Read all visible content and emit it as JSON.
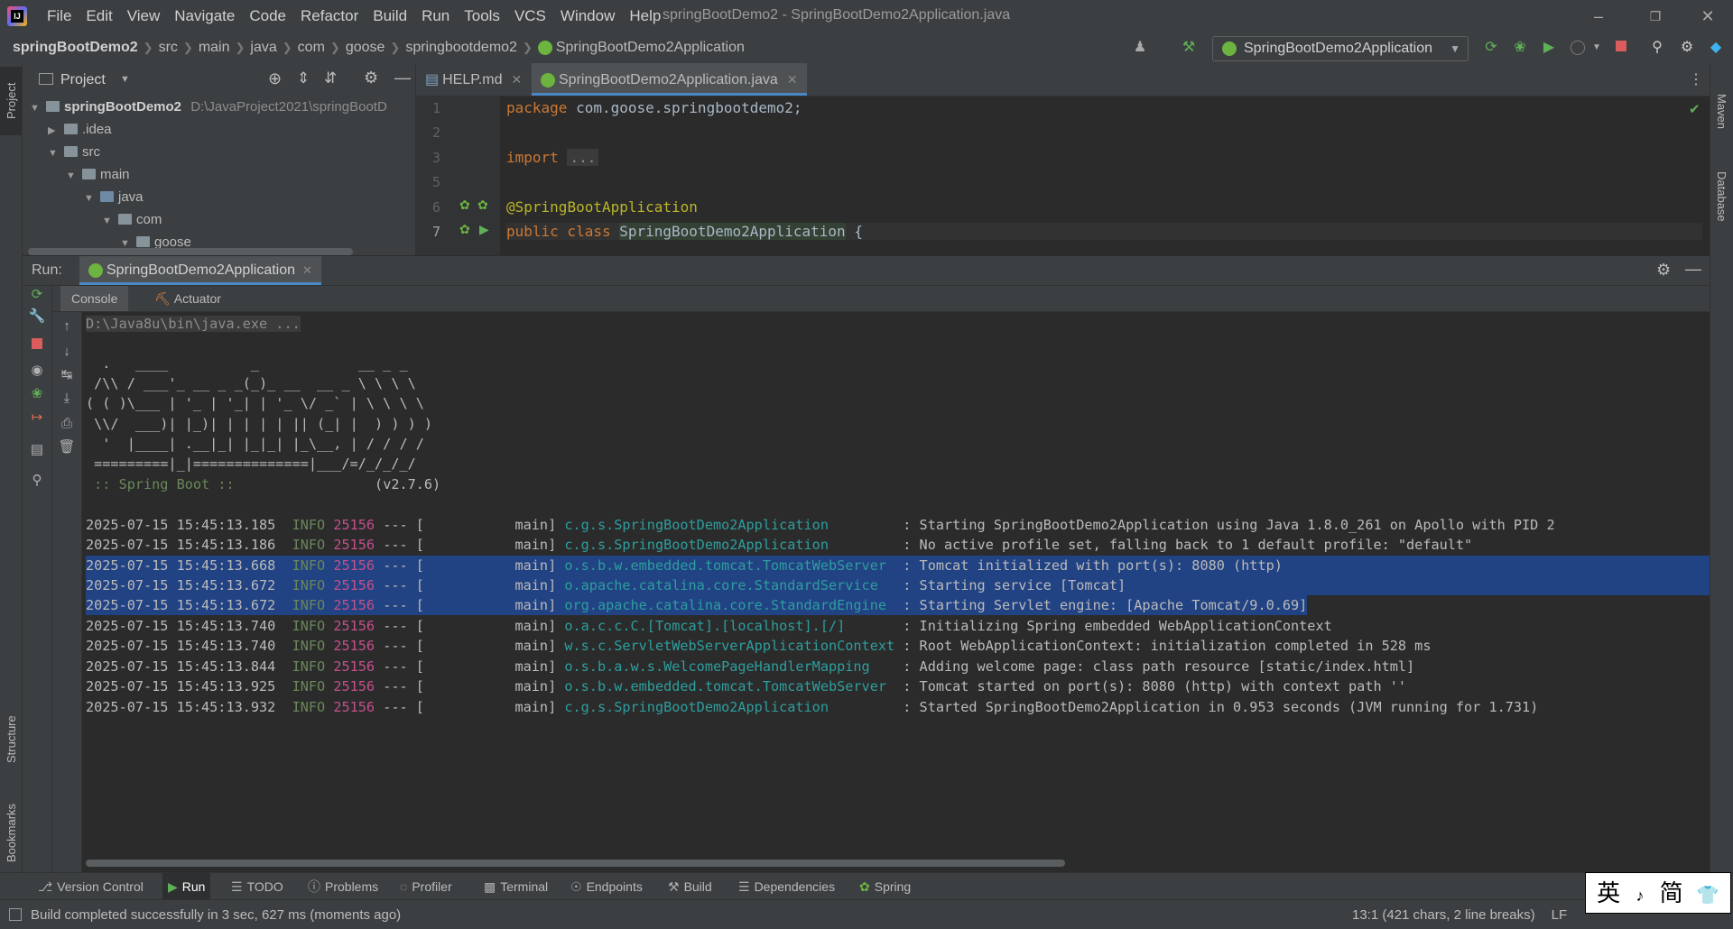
{
  "app_title": "springBootDemo2 - SpringBootDemo2Application.java",
  "menu": [
    "File",
    "Edit",
    "View",
    "Navigate",
    "Code",
    "Refactor",
    "Build",
    "Run",
    "Tools",
    "VCS",
    "Window",
    "Help"
  ],
  "breadcrumbs": [
    "springBootDemo2",
    "src",
    "main",
    "java",
    "com",
    "goose",
    "springbootdemo2",
    "SpringBootDemo2Application"
  ],
  "run_config": "SpringBootDemo2Application",
  "left_stripe": {
    "project": "Project",
    "structure": "Structure",
    "bookmarks": "Bookmarks"
  },
  "right_stripe": {
    "maven": "Maven",
    "database": "Database"
  },
  "project_panel": {
    "title": "Project",
    "tree": [
      {
        "label": "springBootDemo2",
        "path": "D:\\JavaProject2021\\springBootD"
      },
      {
        "label": ".idea"
      },
      {
        "label": "src"
      },
      {
        "label": "main"
      },
      {
        "label": "java"
      },
      {
        "label": "com"
      },
      {
        "label": "goose"
      }
    ]
  },
  "editor": {
    "tabs": [
      {
        "label": "HELP.md"
      },
      {
        "label": "SpringBootDemo2Application.java"
      }
    ],
    "line_numbers": [
      "1",
      "2",
      "3",
      "5",
      "6",
      "7"
    ],
    "code": {
      "l1_kw": "package",
      "l1_rest": " com.goose.springbootdemo2;",
      "l3_kw": "import",
      "l3_fold": "...",
      "l6_at": "@",
      "l6_ann": "SpringBootApplication",
      "l7_kw": "public class",
      "l7_cls": "SpringBootDemo2Application",
      "l7_brace": " {"
    }
  },
  "run_panel": {
    "label": "Run:",
    "tab": "SpringBootDemo2Application",
    "subtabs": [
      "Console",
      "Actuator"
    ],
    "cmdline": "D:\\Java8u\\bin\\java.exe ...",
    "banner": [
      "  .   ____          _            __ _ _",
      " /\\\\ / ___'_ __ _ _(_)_ __  __ _ \\ \\ \\ \\",
      "( ( )\\___ | '_ | '_| | '_ \\/ _` | \\ \\ \\ \\",
      " \\\\/  ___)| |_)| | | | | || (_| |  ) ) ) )",
      "  '  |____| .__|_| |_|_| |_\\__, | / / / /",
      " =========|_|==============|___/=/_/_/_/"
    ],
    "boot_label": " :: Spring Boot ::",
    "boot_version": "(v2.7.6)",
    "logs": [
      {
        "ts": "2025-07-15 15:45:13.185",
        "level": "INFO",
        "pid": "25156",
        "thread": " --- [           main] ",
        "logger": "c.g.s.SpringBootDemo2Application        ",
        "msg": " : Starting SpringBootDemo2Application using Java 1.8.0_261 on Apollo with PID 2"
      },
      {
        "ts": "2025-07-15 15:45:13.186",
        "level": "INFO",
        "pid": "25156",
        "thread": " --- [           main] ",
        "logger": "c.g.s.SpringBootDemo2Application        ",
        "msg": " : No active profile set, falling back to 1 default profile: \"default\""
      },
      {
        "ts": "2025-07-15 15:45:13.668",
        "level": "INFO",
        "pid": "25156",
        "thread": " --- [           main] ",
        "logger": "o.s.b.w.embedded.tomcat.TomcatWebServer ",
        "msg": " : Tomcat initialized with port(s): 8080 (http)"
      },
      {
        "ts": "2025-07-15 15:45:13.672",
        "level": "INFO",
        "pid": "25156",
        "thread": " --- [           main] ",
        "logger": "o.apache.catalina.core.StandardService  ",
        "msg": " : Starting service [Tomcat]"
      },
      {
        "ts": "2025-07-15 15:45:13.672",
        "level": "INFO",
        "pid": "25156",
        "thread": " --- [           main] ",
        "logger": "org.apache.catalina.core.StandardEngine ",
        "msg": " : Starting Servlet engine: [Apache Tomcat/9.0.69]"
      },
      {
        "ts": "2025-07-15 15:45:13.740",
        "level": "INFO",
        "pid": "25156",
        "thread": " --- [           main] ",
        "logger": "o.a.c.c.C.[Tomcat].[localhost].[/]      ",
        "msg": " : Initializing Spring embedded WebApplicationContext"
      },
      {
        "ts": "2025-07-15 15:45:13.740",
        "level": "INFO",
        "pid": "25156",
        "thread": " --- [           main] ",
        "logger": "w.s.c.ServletWebServerApplicationContext",
        "msg": " : Root WebApplicationContext: initialization completed in 528 ms"
      },
      {
        "ts": "2025-07-15 15:45:13.844",
        "level": "INFO",
        "pid": "25156",
        "thread": " --- [           main] ",
        "logger": "o.s.b.a.w.s.WelcomePageHandlerMapping   ",
        "msg": " : Adding welcome page: class path resource [static/index.html]"
      },
      {
        "ts": "2025-07-15 15:45:13.925",
        "level": "INFO",
        "pid": "25156",
        "thread": " --- [           main] ",
        "logger": "o.s.b.w.embedded.tomcat.TomcatWebServer ",
        "msg": " : Tomcat started on port(s): 8080 (http) with context path ''"
      },
      {
        "ts": "2025-07-15 15:45:13.932",
        "level": "INFO",
        "pid": "25156",
        "thread": " --- [           main] ",
        "logger": "c.g.s.SpringBootDemo2Application        ",
        "msg": " : Started SpringBootDemo2Application in 0.953 seconds (JVM running for 1.731)"
      }
    ]
  },
  "bottom_tools": [
    "Version Control",
    "Run",
    "TODO",
    "Problems",
    "Profiler",
    "Terminal",
    "Endpoints",
    "Build",
    "Dependencies",
    "Spring"
  ],
  "status": {
    "message": "Build completed successfully in 3 sec, 627 ms (moments ago)",
    "position": "13:1 (421 chars, 2 line breaks)",
    "line_sep": "LF"
  },
  "ime": {
    "lang": "英",
    "sep": "♪",
    "mode": "简"
  }
}
